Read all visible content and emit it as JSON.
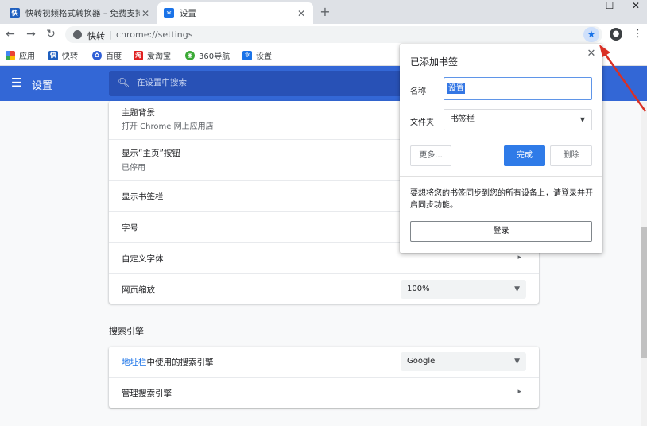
{
  "tabs": [
    {
      "title": "快转视频格式转换器 – 免费支持高",
      "favicon": "快"
    },
    {
      "title": "设置",
      "favicon": "gear-icon"
    }
  ],
  "omnibox": {
    "site": "快转",
    "separator": "|",
    "url": "chrome://settings"
  },
  "bookmarks": [
    {
      "label": "应用",
      "icon": "apps-grid-icon"
    },
    {
      "label": "快转",
      "icon": "快"
    },
    {
      "label": "百度",
      "icon": "baidu-paw-icon"
    },
    {
      "label": "爱淘宝",
      "icon": "淘"
    },
    {
      "label": "360导航",
      "icon": "360-icon"
    },
    {
      "label": "设置",
      "icon": "gear-icon"
    }
  ],
  "header": {
    "title": "设置",
    "search_placeholder": "在设置中搜索"
  },
  "appearance": {
    "theme_title": "主题背景",
    "theme_sub": "打开 Chrome 网上应用店",
    "home_button_title": "显示“主页”按钮",
    "home_button_sub": "已停用",
    "bookmarks_bar": "显示书签栏",
    "font_size": "字号",
    "custom_fonts": "自定义字体",
    "page_zoom": "网页缩放",
    "page_zoom_value": "100%"
  },
  "search_engine": {
    "section_title": "搜索引擎",
    "address_bar_link": "地址栏",
    "address_bar_rest": "中使用的搜索引擎",
    "engine_value": "Google",
    "manage": "管理搜索引擎"
  },
  "bubble": {
    "title": "已添加书签",
    "name_label": "名称",
    "name_value": "设置",
    "folder_label": "文件夹",
    "folder_value": "书签栏",
    "more_button": "更多...",
    "done_button": "完成",
    "remove_button": "删除",
    "sync_text": "要想将您的书签同步到您的所有设备上，请登录并开启同步功能。",
    "signin_button": "登录"
  },
  "colors": {
    "header_blue": "#3367d6",
    "accent_blue": "#1a73e8",
    "annotation_red": "#d93025"
  }
}
